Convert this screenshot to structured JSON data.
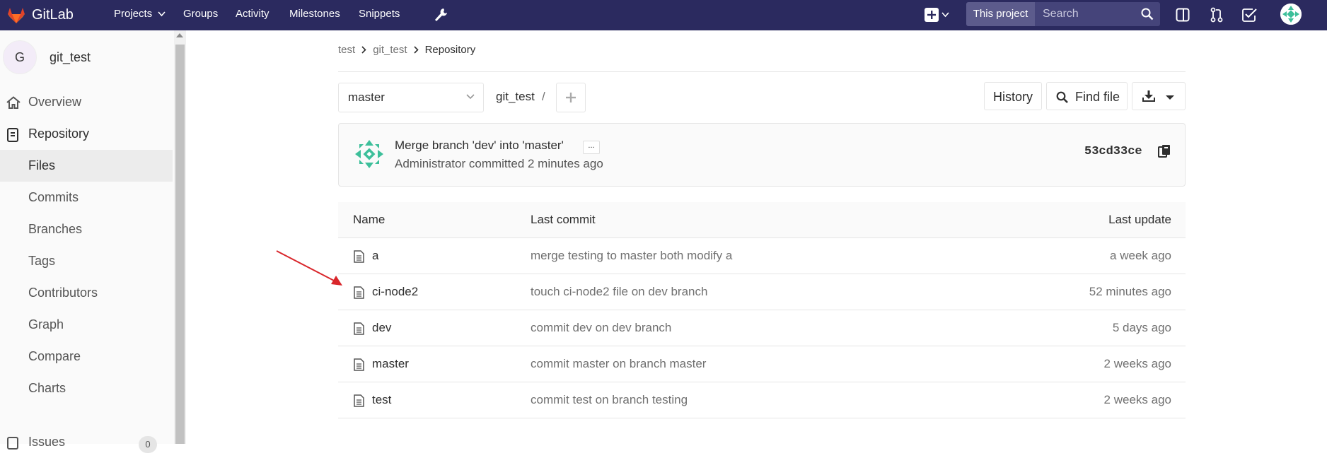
{
  "topnav": {
    "brand": "GitLab",
    "links": [
      "Projects",
      "Groups",
      "Activity",
      "Milestones",
      "Snippets"
    ],
    "scope": "This project",
    "search_placeholder": "Search"
  },
  "sidebar": {
    "project_initial": "G",
    "project_name": "git_test",
    "overview": "Overview",
    "repository": "Repository",
    "items": [
      "Files",
      "Commits",
      "Branches",
      "Tags",
      "Contributors",
      "Graph",
      "Compare",
      "Charts"
    ],
    "issues_label": "Issues",
    "issues_count": "0"
  },
  "breadcrumb": [
    "test",
    "git_test",
    "Repository"
  ],
  "toolbar": {
    "branch": "master",
    "path_root": "git_test",
    "path_sep": "/",
    "history": "History",
    "find_file": "Find file"
  },
  "commit": {
    "title": "Merge branch 'dev' into 'master'",
    "more": "...",
    "meta": "Administrator committed 2 minutes ago",
    "sha": "53cd33ce"
  },
  "tree": {
    "headers": [
      "Name",
      "Last commit",
      "Last update"
    ],
    "rows": [
      {
        "name": "a",
        "commit": "merge testing to master both modify a",
        "updated": "a week ago"
      },
      {
        "name": "ci-node2",
        "commit": "touch ci-node2 file on dev branch",
        "updated": "52 minutes ago"
      },
      {
        "name": "dev",
        "commit": "commit dev on dev branch",
        "updated": "5 days ago"
      },
      {
        "name": "master",
        "commit": "commit master on branch master",
        "updated": "2 weeks ago"
      },
      {
        "name": "test",
        "commit": "commit test on branch testing",
        "updated": "2 weeks ago"
      }
    ]
  },
  "colors": {
    "nav_bg": "#2b2a5f",
    "annotation_arrow": "#d9262b",
    "avatar_identicon": "#3dbf9a"
  },
  "icons": [
    "gitlab-logo-icon",
    "wrench-icon",
    "plus-square-icon",
    "sidebar-toggle-icon",
    "merge-request-icon",
    "todo-check-icon",
    "search-icon",
    "home-icon",
    "book-icon",
    "plus-icon",
    "search-icon",
    "download-icon",
    "copy-icon",
    "file-icon"
  ]
}
